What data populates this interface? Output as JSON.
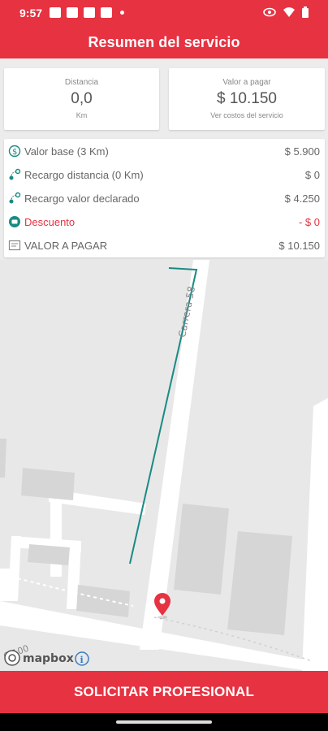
{
  "status_bar": {
    "time": "9:57"
  },
  "header": {
    "title": "Resumen del servicio"
  },
  "distance": {
    "label": "Distancia",
    "value": "0,0",
    "unit": "Km"
  },
  "payment": {
    "label": "Valor a pagar",
    "value": "$ 10.150",
    "link": "Ver costos del servicio"
  },
  "breakdown": [
    {
      "name": "Valor base (3 Km)",
      "amount": "$ 5.900",
      "icon": "dollar-circle-icon"
    },
    {
      "name": "Recargo distancia (0 Km)",
      "amount": "$ 0",
      "icon": "route-icon"
    },
    {
      "name": "Recargo valor declarado",
      "amount": "$ 4.250",
      "icon": "route-icon"
    },
    {
      "name": "Descuento",
      "amount": "- $ 0",
      "icon": "discount-icon"
    },
    {
      "name": "VALOR A PAGAR",
      "amount": "$ 10.150",
      "icon": "receipt-icon"
    }
  ],
  "map": {
    "street_label": "Carrera 58",
    "street_label_2": "C 100",
    "attribution": "mapbox"
  },
  "cta": {
    "label": "SOLICITAR PROFESIONAL"
  },
  "colors": {
    "primary": "#e63241",
    "route": "#1a8a84",
    "text": "#666666"
  }
}
